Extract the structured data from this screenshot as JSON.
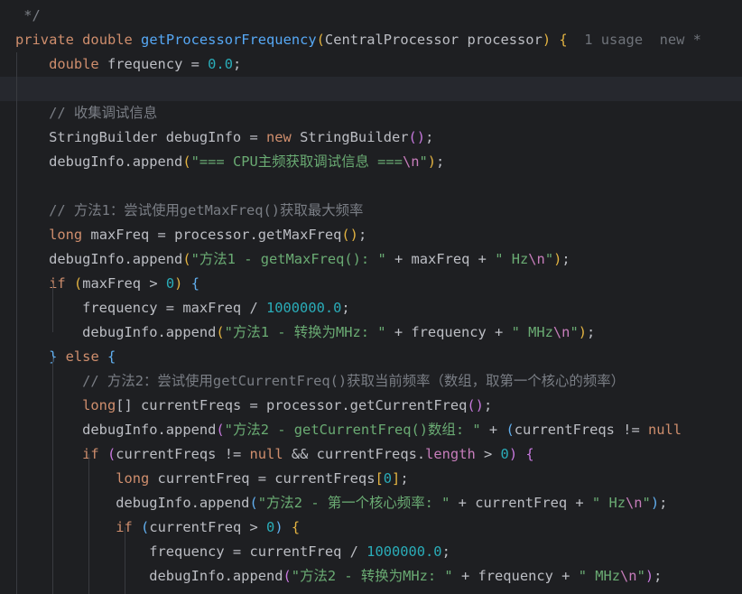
{
  "editor": {
    "lines": [
      [
        {
          "t": " */",
          "c": "cmt"
        }
      ],
      [
        {
          "t": "private",
          "c": "kw"
        },
        {
          "t": " ",
          "c": "plain"
        },
        {
          "t": "double",
          "c": "kw"
        },
        {
          "t": " ",
          "c": "plain"
        },
        {
          "t": "getProcessorFrequency",
          "c": "fn"
        },
        {
          "t": "(",
          "c": "bracket-y"
        },
        {
          "t": "CentralProcessor processor",
          "c": "plain"
        },
        {
          "t": ")",
          "c": "bracket-y"
        },
        {
          "t": " ",
          "c": "plain"
        },
        {
          "t": "{",
          "c": "bracket-y"
        },
        {
          "t": "  1 usage  new *",
          "c": "hint"
        }
      ],
      [
        {
          "t": "    ",
          "c": "plain"
        },
        {
          "t": "double",
          "c": "kw"
        },
        {
          "t": " frequency = ",
          "c": "plain"
        },
        {
          "t": "0.0",
          "c": "num"
        },
        {
          "t": ";",
          "c": "plain"
        }
      ],
      [
        {
          "t": "",
          "c": "plain"
        }
      ],
      [
        {
          "t": "    // 收集调试信息",
          "c": "cmt"
        }
      ],
      [
        {
          "t": "    StringBuilder debugInfo = ",
          "c": "plain"
        },
        {
          "t": "new",
          "c": "kw"
        },
        {
          "t": " StringBuilder",
          "c": "plain"
        },
        {
          "t": "()",
          "c": "bracket-p"
        },
        {
          "t": ";",
          "c": "plain"
        }
      ],
      [
        {
          "t": "    debugInfo.append",
          "c": "plain"
        },
        {
          "t": "(",
          "c": "bracket-y"
        },
        {
          "t": "\"=== CPU主频获取调试信息 ===",
          "c": "str"
        },
        {
          "t": "\\n",
          "c": "fld"
        },
        {
          "t": "\"",
          "c": "str"
        },
        {
          "t": ")",
          "c": "bracket-y"
        },
        {
          "t": ";",
          "c": "plain"
        }
      ],
      [
        {
          "t": "",
          "c": "plain"
        }
      ],
      [
        {
          "t": "    // 方法1：尝试使用getMaxFreq()获取最大频率",
          "c": "cmt"
        }
      ],
      [
        {
          "t": "    ",
          "c": "plain"
        },
        {
          "t": "long",
          "c": "kw"
        },
        {
          "t": " maxFreq = processor.getMaxFreq",
          "c": "plain"
        },
        {
          "t": "()",
          "c": "bracket-y"
        },
        {
          "t": ";",
          "c": "plain"
        }
      ],
      [
        {
          "t": "    debugInfo.append",
          "c": "plain"
        },
        {
          "t": "(",
          "c": "bracket-y"
        },
        {
          "t": "\"方法1 - getMaxFreq(): \"",
          "c": "str"
        },
        {
          "t": " + maxFreq + ",
          "c": "plain"
        },
        {
          "t": "\" Hz",
          "c": "str"
        },
        {
          "t": "\\n",
          "c": "fld"
        },
        {
          "t": "\"",
          "c": "str"
        },
        {
          "t": ")",
          "c": "bracket-y"
        },
        {
          "t": ";",
          "c": "plain"
        }
      ],
      [
        {
          "t": "    ",
          "c": "plain"
        },
        {
          "t": "if",
          "c": "kw"
        },
        {
          "t": " ",
          "c": "plain"
        },
        {
          "t": "(",
          "c": "bracket-y"
        },
        {
          "t": "maxFreq > ",
          "c": "plain"
        },
        {
          "t": "0",
          "c": "num"
        },
        {
          "t": ")",
          "c": "bracket-y"
        },
        {
          "t": " ",
          "c": "plain"
        },
        {
          "t": "{",
          "c": "bracket-b"
        }
      ],
      [
        {
          "t": "        frequency = maxFreq / ",
          "c": "plain"
        },
        {
          "t": "1000000.0",
          "c": "num"
        },
        {
          "t": ";",
          "c": "plain"
        }
      ],
      [
        {
          "t": "        debugInfo.append",
          "c": "plain"
        },
        {
          "t": "(",
          "c": "bracket-y"
        },
        {
          "t": "\"方法1 - 转换为MHz: \"",
          "c": "str"
        },
        {
          "t": " + frequency + ",
          "c": "plain"
        },
        {
          "t": "\" MHz",
          "c": "str"
        },
        {
          "t": "\\n",
          "c": "fld"
        },
        {
          "t": "\"",
          "c": "str"
        },
        {
          "t": ")",
          "c": "bracket-y"
        },
        {
          "t": ";",
          "c": "plain"
        }
      ],
      [
        {
          "t": "    ",
          "c": "plain"
        },
        {
          "t": "}",
          "c": "bracket-b"
        },
        {
          "t": " ",
          "c": "plain"
        },
        {
          "t": "else",
          "c": "kw"
        },
        {
          "t": " ",
          "c": "plain"
        },
        {
          "t": "{",
          "c": "bracket-b"
        }
      ],
      [
        {
          "t": "        // 方法2：尝试使用getCurrentFreq()获取当前频率（数组，取第一个核心的频率）",
          "c": "cmt"
        }
      ],
      [
        {
          "t": "        ",
          "c": "plain"
        },
        {
          "t": "long",
          "c": "kw"
        },
        {
          "t": "[]",
          "c": "plain"
        },
        {
          "t": " currentFreqs = processor.getCurrentFreq",
          "c": "plain"
        },
        {
          "t": "()",
          "c": "bracket-p"
        },
        {
          "t": ";",
          "c": "plain"
        }
      ],
      [
        {
          "t": "        debugInfo.append",
          "c": "plain"
        },
        {
          "t": "(",
          "c": "bracket-p"
        },
        {
          "t": "\"方法2 - getCurrentFreq()数组: \"",
          "c": "str"
        },
        {
          "t": " + ",
          "c": "plain"
        },
        {
          "t": "(",
          "c": "bracket-b"
        },
        {
          "t": "currentFreqs != ",
          "c": "plain"
        },
        {
          "t": "null",
          "c": "kw"
        }
      ],
      [
        {
          "t": "        ",
          "c": "plain"
        },
        {
          "t": "if",
          "c": "kw"
        },
        {
          "t": " ",
          "c": "plain"
        },
        {
          "t": "(",
          "c": "bracket-p"
        },
        {
          "t": "currentFreqs != ",
          "c": "plain"
        },
        {
          "t": "null",
          "c": "kw"
        },
        {
          "t": " && currentFreqs.",
          "c": "plain"
        },
        {
          "t": "length",
          "c": "fld"
        },
        {
          "t": " > ",
          "c": "plain"
        },
        {
          "t": "0",
          "c": "num"
        },
        {
          "t": ")",
          "c": "bracket-p"
        },
        {
          "t": " ",
          "c": "plain"
        },
        {
          "t": "{",
          "c": "bracket-p"
        }
      ],
      [
        {
          "t": "            ",
          "c": "plain"
        },
        {
          "t": "long",
          "c": "kw"
        },
        {
          "t": " currentFreq = currentFreqs",
          "c": "plain"
        },
        {
          "t": "[",
          "c": "bracket-y"
        },
        {
          "t": "0",
          "c": "num"
        },
        {
          "t": "]",
          "c": "bracket-y"
        },
        {
          "t": ";",
          "c": "plain"
        }
      ],
      [
        {
          "t": "            debugInfo.append",
          "c": "plain"
        },
        {
          "t": "(",
          "c": "bracket-b"
        },
        {
          "t": "\"方法2 - 第一个核心频率: \"",
          "c": "str"
        },
        {
          "t": " + currentFreq + ",
          "c": "plain"
        },
        {
          "t": "\" Hz",
          "c": "str"
        },
        {
          "t": "\\n",
          "c": "fld"
        },
        {
          "t": "\"",
          "c": "str"
        },
        {
          "t": ")",
          "c": "bracket-b"
        },
        {
          "t": ";",
          "c": "plain"
        }
      ],
      [
        {
          "t": "            ",
          "c": "plain"
        },
        {
          "t": "if",
          "c": "kw"
        },
        {
          "t": " ",
          "c": "plain"
        },
        {
          "t": "(",
          "c": "bracket-b"
        },
        {
          "t": "currentFreq > ",
          "c": "plain"
        },
        {
          "t": "0",
          "c": "num"
        },
        {
          "t": ")",
          "c": "bracket-b"
        },
        {
          "t": " ",
          "c": "plain"
        },
        {
          "t": "{",
          "c": "bracket-y"
        }
      ],
      [
        {
          "t": "                frequency = currentFreq / ",
          "c": "plain"
        },
        {
          "t": "1000000.0",
          "c": "num"
        },
        {
          "t": ";",
          "c": "plain"
        }
      ],
      [
        {
          "t": "                debugInfo.append",
          "c": "plain"
        },
        {
          "t": "(",
          "c": "bracket-p"
        },
        {
          "t": "\"方法2 - 转换为MHz: \"",
          "c": "str"
        },
        {
          "t": " + frequency + ",
          "c": "plain"
        },
        {
          "t": "\" MHz",
          "c": "str"
        },
        {
          "t": "\\n",
          "c": "fld"
        },
        {
          "t": "\"",
          "c": "str"
        },
        {
          "t": ")",
          "c": "bracket-p"
        },
        {
          "t": ";",
          "c": "plain"
        }
      ],
      [
        {
          "t": "            ",
          "c": "plain"
        },
        {
          "t": "}",
          "c": "bracket-y"
        }
      ]
    ]
  }
}
